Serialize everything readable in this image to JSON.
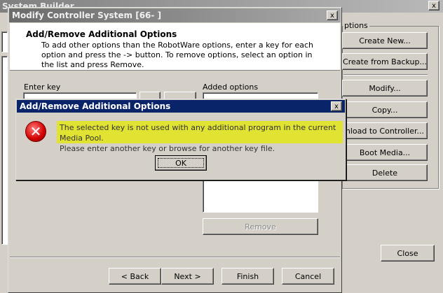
{
  "system_builder": {
    "title": "System Builder",
    "options_label": "ptions",
    "buttons": {
      "create_new": "Create New...",
      "create_from_backup": "Create from Backup...",
      "modify": "Modify...",
      "copy": "Copy...",
      "download": "wnload to Controller...",
      "boot_media": "Boot Media...",
      "delete": "Delete",
      "close": "Close"
    },
    "close_glyph": "x"
  },
  "modify_dialog": {
    "title": "Modify Controller System [66-          ]",
    "heading": "Add/Remove Additional Options",
    "description": "To add other options than the RobotWare options, enter a key for each option and press the -> button. To remove options, select an option in the list and press Remove.",
    "enter_key_label": "Enter key",
    "added_options_label": "Added options",
    "remove_button": "Remove",
    "back_button": "< Back",
    "next_button": "Next >",
    "finish_button": "Finish",
    "cancel_button": "Cancel",
    "close_glyph": "x"
  },
  "alert": {
    "title": "Add/Remove Additional Options",
    "message_line1": "The selected key is not used with any additional program in the current Media Pool.",
    "message_line2": "Please enter another key or browse for another key file.",
    "ok_button": "OK",
    "close_glyph": "x",
    "error_glyph": "✕",
    "highlight_color": "#e1e332"
  }
}
